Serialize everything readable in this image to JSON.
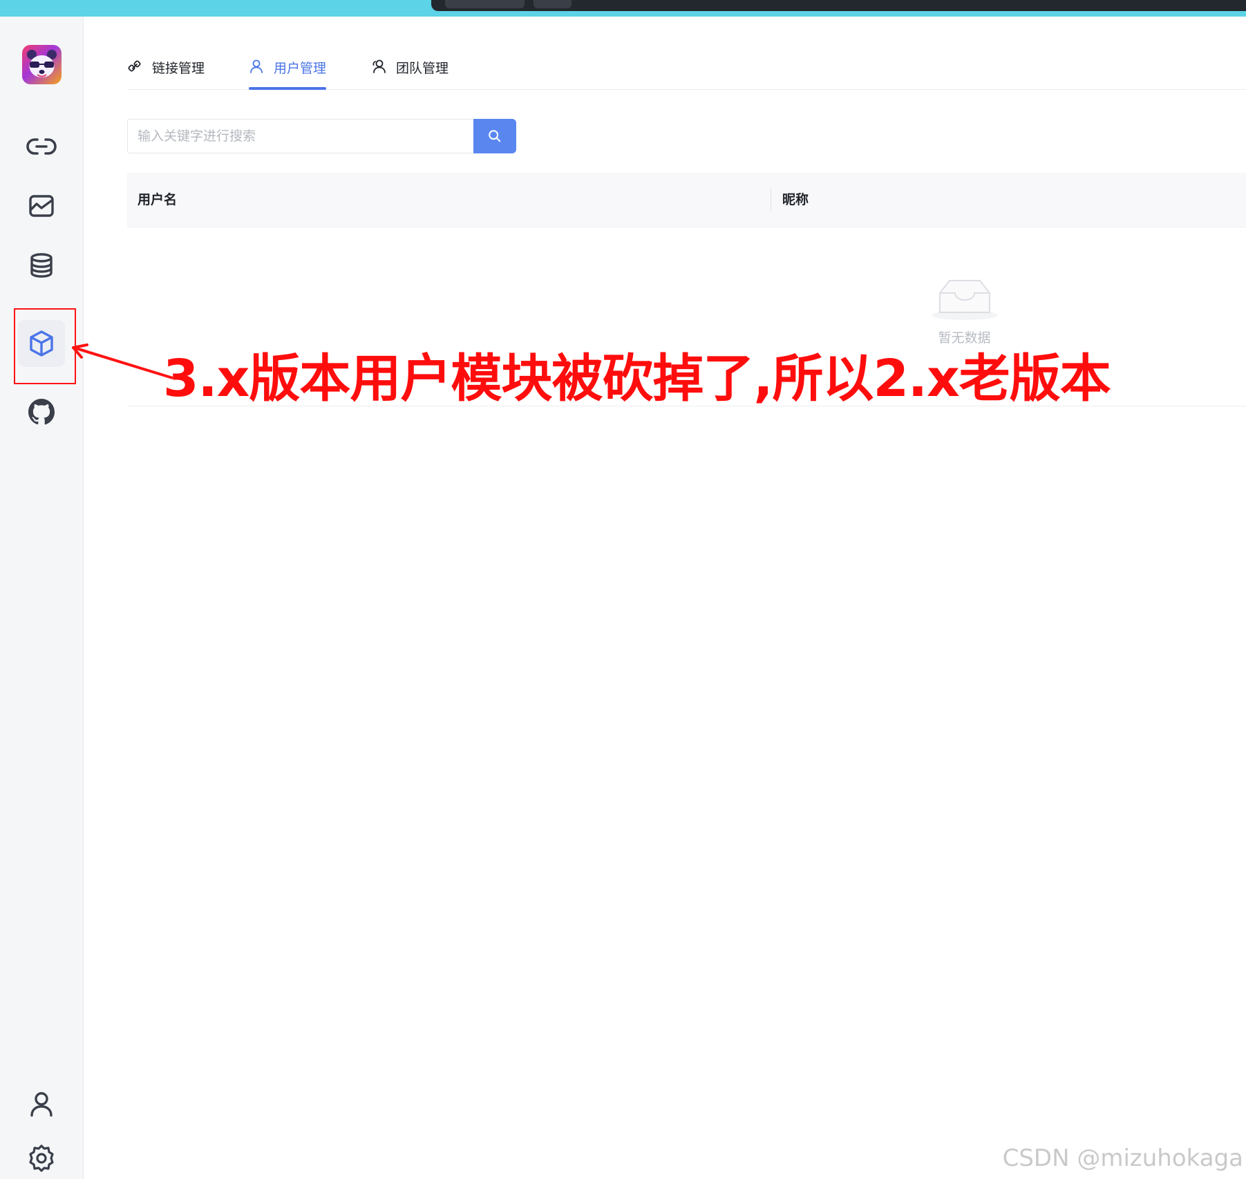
{
  "tabs": [
    {
      "label": "链接管理",
      "icon": "link-chain-icon",
      "active": false
    },
    {
      "label": "用户管理",
      "icon": "user-icon",
      "active": true
    },
    {
      "label": "团队管理",
      "icon": "team-icon",
      "active": false
    }
  ],
  "sidebar": {
    "items": [
      {
        "icon": "link-icon"
      },
      {
        "icon": "chart-icon"
      },
      {
        "icon": "database-icon"
      },
      {
        "icon": "cube-icon",
        "active": true
      },
      {
        "icon": "github-icon"
      }
    ],
    "bottom": [
      {
        "icon": "user-icon"
      },
      {
        "icon": "settings-icon"
      }
    ]
  },
  "search": {
    "placeholder": "输入关键字进行搜索",
    "value": ""
  },
  "table": {
    "columns": [
      "用户名",
      "昵称"
    ],
    "rows": [],
    "empty_text": "暂无数据"
  },
  "annotation": {
    "text": "3.x版本用户模块被砍掉了,所以2.x老版本"
  },
  "watermark": "CSDN @mizuhokaga",
  "colors": {
    "accent": "#4b74e8",
    "search_button": "#5a86f0",
    "annotation": "#ff0d0d",
    "topbar": "#5cd3e6"
  }
}
